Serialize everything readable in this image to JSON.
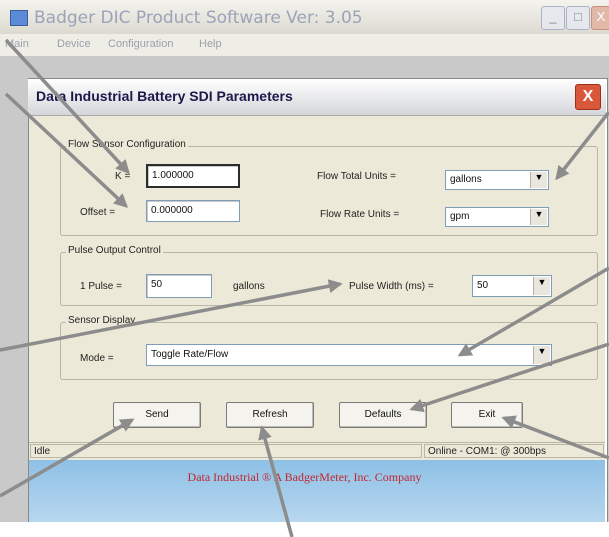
{
  "app": {
    "title": "Badger DIC Product Software Ver: 3.05",
    "menu": [
      "Main",
      "Device",
      "Configuration",
      "Help"
    ],
    "minimize_icon": "minimize-icon",
    "maximize_icon": "maximize-icon",
    "close_icon": "close-icon"
  },
  "dialog": {
    "title": "Data Industrial Battery SDI Parameters",
    "close_symbol": "X",
    "flow_sensor": {
      "group_label": "Flow Sensor Configuration",
      "k_label": "K =",
      "k_value": "1.000000",
      "offset_label": "Offset =",
      "offset_value": "0.000000",
      "flow_total_units_label": "Flow Total Units =",
      "flow_total_units_value": "gallons",
      "flow_rate_units_label": "Flow Rate Units =",
      "flow_rate_units_value": "gpm"
    },
    "pulse_output": {
      "group_label": "Pulse Output Control",
      "pulse_label": "1 Pulse =",
      "pulse_value": "50",
      "pulse_units": "gallons",
      "pulse_width_label": "Pulse Width (ms) =",
      "pulse_width_value": "50"
    },
    "sensor_display": {
      "group_label": "Sensor Display",
      "mode_label": "Mode =",
      "mode_value": "Toggle Rate/Flow"
    },
    "buttons": {
      "send": "Send",
      "refresh": "Refresh",
      "defaults": "Defaults",
      "exit": "Exit"
    },
    "status": {
      "left": "Idle",
      "right": "Online - COM1: @ 300bps"
    },
    "footer": "Data Industrial ® A BadgerMeter, Inc. Company"
  },
  "colors": {
    "dialog_face": "#ece9d8",
    "footer_text": "#c0282f",
    "footer_band": "#8ec0e6",
    "pointer_arrows": "#8c8c8c",
    "close_button": "#d9573a"
  }
}
